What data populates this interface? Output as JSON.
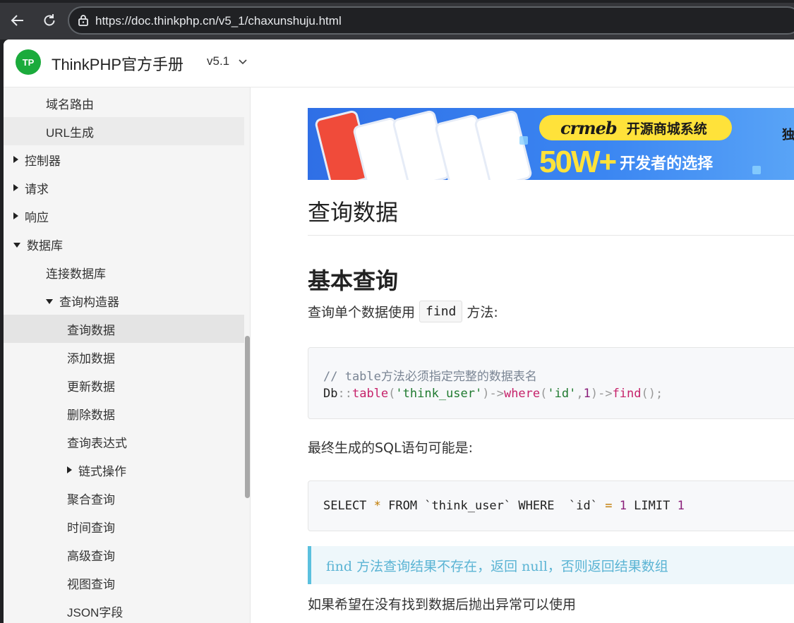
{
  "browser": {
    "url": "https://doc.thinkphp.cn/v5_1/chaxunshuju.html"
  },
  "header": {
    "logo_text": "TP",
    "title": "ThinkPHP官方手册",
    "version": "v5.1",
    "brand_color": "#1bab3c"
  },
  "sidebar": {
    "items": [
      {
        "label": "域名路由",
        "indent": 1,
        "caret": "none",
        "state": ""
      },
      {
        "label": "URL生成",
        "indent": 1,
        "caret": "none",
        "state": "hover"
      },
      {
        "label": "控制器",
        "indent": 0,
        "caret": "right",
        "state": ""
      },
      {
        "label": "请求",
        "indent": 0,
        "caret": "right",
        "state": ""
      },
      {
        "label": "响应",
        "indent": 0,
        "caret": "right",
        "state": ""
      },
      {
        "label": "数据库",
        "indent": 0,
        "caret": "down",
        "state": ""
      },
      {
        "label": "连接数据库",
        "indent": 1,
        "caret": "none",
        "state": ""
      },
      {
        "label": "查询构造器",
        "indent": 1,
        "caret": "down",
        "state": ""
      },
      {
        "label": "查询数据",
        "indent": 2,
        "caret": "none",
        "state": "active"
      },
      {
        "label": "添加数据",
        "indent": 2,
        "caret": "none",
        "state": ""
      },
      {
        "label": "更新数据",
        "indent": 2,
        "caret": "none",
        "state": ""
      },
      {
        "label": "删除数据",
        "indent": 2,
        "caret": "none",
        "state": ""
      },
      {
        "label": "查询表达式",
        "indent": 2,
        "caret": "none",
        "state": ""
      },
      {
        "label": "链式操作",
        "indent": 2,
        "caret": "right",
        "state": ""
      },
      {
        "label": "聚合查询",
        "indent": 2,
        "caret": "none",
        "state": ""
      },
      {
        "label": "时间查询",
        "indent": 2,
        "caret": "none",
        "state": ""
      },
      {
        "label": "高级查询",
        "indent": 2,
        "caret": "none",
        "state": ""
      },
      {
        "label": "视图查询",
        "indent": 2,
        "caret": "none",
        "state": ""
      },
      {
        "label": "JSON字段",
        "indent": 2,
        "caret": "none",
        "state": ""
      }
    ]
  },
  "banner": {
    "brand": "crmeb",
    "brand_tag": "开源商城系统",
    "headline_big": "50W+",
    "headline_small": "开发者的选择",
    "edge_text": "独"
  },
  "content": {
    "page_title": "查询数据",
    "section_title": "基本查询",
    "para1_before": "查询单个数据使用",
    "para1_code": "find",
    "para1_after": "方法:",
    "code1": {
      "comment": "// table方法必须指定完整的数据表名",
      "line2": [
        {
          "t": "Db",
          "c": "c-plain"
        },
        {
          "t": "::",
          "c": "c-op"
        },
        {
          "t": "table",
          "c": "c-fn"
        },
        {
          "t": "(",
          "c": "c-op"
        },
        {
          "t": "'think_user'",
          "c": "c-str"
        },
        {
          "t": ")->",
          "c": "c-op"
        },
        {
          "t": "where",
          "c": "c-fn"
        },
        {
          "t": "(",
          "c": "c-op"
        },
        {
          "t": "'id'",
          "c": "c-str"
        },
        {
          "t": ",",
          "c": "c-op"
        },
        {
          "t": "1",
          "c": "c-num"
        },
        {
          "t": ")->",
          "c": "c-op"
        },
        {
          "t": "find",
          "c": "c-fn"
        },
        {
          "t": "();",
          "c": "c-op"
        }
      ]
    },
    "para2": "最终生成的SQL语句可能是:",
    "code2": [
      {
        "t": "SELECT ",
        "c": "c-plain"
      },
      {
        "t": "*",
        "c": "c-star"
      },
      {
        "t": " FROM `think_user` WHERE  `id` ",
        "c": "c-plain"
      },
      {
        "t": "=",
        "c": "c-star"
      },
      {
        "t": " ",
        "c": "c-plain"
      },
      {
        "t": "1",
        "c": "c-num"
      },
      {
        "t": " LIMIT ",
        "c": "c-plain"
      },
      {
        "t": "1",
        "c": "c-num"
      }
    ],
    "note": "find 方法查询结果不存在，返回 null，否则返回结果数组",
    "para3": "如果希望在没有找到数据后抛出异常可以使用"
  }
}
